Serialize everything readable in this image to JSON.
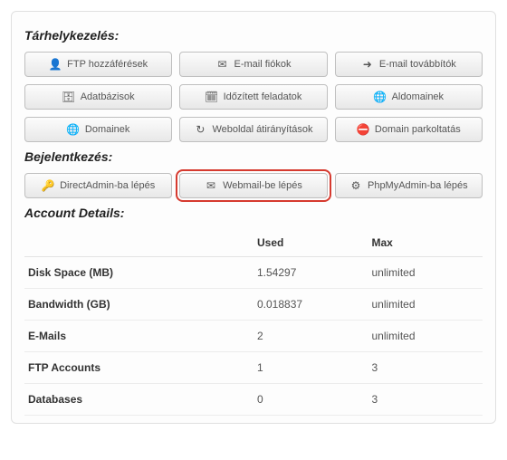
{
  "sections": {
    "storage": {
      "title": "Tárhelykezelés:",
      "rows": [
        [
          {
            "label": "FTP hozzáférések",
            "icon": "user-icon"
          },
          {
            "label": "E-mail fiókok",
            "icon": "mail-icon"
          },
          {
            "label": "E-mail továbbítók",
            "icon": "forward-icon"
          }
        ],
        [
          {
            "label": "Adatbázisok",
            "icon": "db-icon"
          },
          {
            "label": "Időzített feladatok",
            "icon": "clock-icon"
          },
          {
            "label": "Aldomainek",
            "icon": "globe-icon"
          }
        ],
        [
          {
            "label": "Domainek",
            "icon": "globe-icon"
          },
          {
            "label": "Weboldal átirányítások",
            "icon": "reload-icon"
          },
          {
            "label": "Domain parkoltatás",
            "icon": "park-icon"
          }
        ]
      ]
    },
    "login": {
      "title": "Bejelentkezés:",
      "buttons": [
        {
          "label": "DirectAdmin-ba lépés",
          "icon": "key-icon"
        },
        {
          "label": "Webmail-be lépés",
          "icon": "mail-icon",
          "highlight": true
        },
        {
          "label": "PhpMyAdmin-ba lépés",
          "icon": "pma-icon"
        }
      ]
    },
    "account": {
      "title": "Account Details:",
      "headers": {
        "col1": "",
        "col2": "Used",
        "col3": "Max"
      },
      "rows": [
        {
          "label": "Disk Space (MB)",
          "used": "1.54297",
          "max": "unlimited"
        },
        {
          "label": "Bandwidth (GB)",
          "used": "0.018837",
          "max": "unlimited"
        },
        {
          "label": "E-Mails",
          "used": "2",
          "max": "unlimited"
        },
        {
          "label": "FTP Accounts",
          "used": "1",
          "max": "3"
        },
        {
          "label": "Databases",
          "used": "0",
          "max": "3"
        }
      ]
    }
  },
  "icons": {
    "user-icon": "👤",
    "mail-icon": "✉",
    "forward-icon": "➜",
    "db-icon": "🗄",
    "clock-icon": "🗓",
    "globe-icon": "🌐",
    "reload-icon": "↻",
    "park-icon": "⛔",
    "key-icon": "🔑",
    "pma-icon": "⚙"
  },
  "colors": {
    "highlight_border": "#d63a2f"
  }
}
